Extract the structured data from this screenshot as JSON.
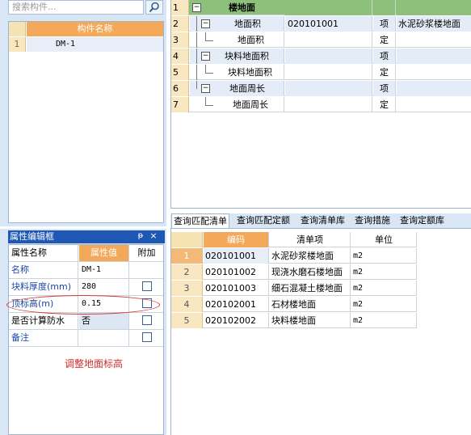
{
  "search": {
    "placeholder": "搜索构件..."
  },
  "components": {
    "header_name": "构件名称",
    "rows": [
      {
        "index": "1",
        "name": "DM-1"
      }
    ]
  },
  "property_panel": {
    "title": "属性编辑框",
    "pin_glyph": "ᵽ",
    "close_glyph": "×",
    "headers": {
      "name": "属性名称",
      "value": "属性值",
      "extra": "附加"
    },
    "rows": [
      {
        "name": "名称",
        "value": "DM-1",
        "checkbox": false
      },
      {
        "name": "块料厚度(mm)",
        "value": "280",
        "checkbox": true
      },
      {
        "name": "顶标高(m)",
        "value": "0.15",
        "checkbox": true
      },
      {
        "name": "是否计算防水",
        "value": "否",
        "checkbox": true
      },
      {
        "name": "备注",
        "value": "",
        "checkbox": true
      }
    ],
    "annotation": "调整地面标高"
  },
  "tree": {
    "rows": [
      {
        "index": "1",
        "label": "楼地面",
        "code": "",
        "unit": "",
        "desc": ""
      },
      {
        "index": "2",
        "label": "地面积",
        "code": "020101001",
        "unit": "项",
        "desc": "水泥砂浆楼地面"
      },
      {
        "index": "3",
        "label": "地面积",
        "code": "",
        "unit": "定",
        "desc": ""
      },
      {
        "index": "4",
        "label": "块料地面积",
        "code": "",
        "unit": "项",
        "desc": ""
      },
      {
        "index": "5",
        "label": "块料地面积",
        "code": "",
        "unit": "定",
        "desc": ""
      },
      {
        "index": "6",
        "label": "地面周长",
        "code": "",
        "unit": "项",
        "desc": ""
      },
      {
        "index": "7",
        "label": "地面周长",
        "code": "",
        "unit": "定",
        "desc": ""
      }
    ],
    "collapse_glyph": "−"
  },
  "tabs": [
    {
      "label": "查询匹配清单",
      "active": true
    },
    {
      "label": "查询匹配定额",
      "active": false
    },
    {
      "label": "查询清单库",
      "active": false
    },
    {
      "label": "查询措施",
      "active": false
    },
    {
      "label": "查询定额库",
      "active": false
    }
  ],
  "match_table": {
    "headers": {
      "code": "编码",
      "name": "清单项",
      "unit": "单位"
    },
    "rows": [
      {
        "index": "1",
        "code": "020101001",
        "name": "水泥砂浆楼地面",
        "unit": "m2"
      },
      {
        "index": "2",
        "code": "020101002",
        "name": "现浇水磨石楼地面",
        "unit": "m2"
      },
      {
        "index": "3",
        "code": "020101003",
        "name": "细石混凝土楼地面",
        "unit": "m2"
      },
      {
        "index": "4",
        "code": "020102001",
        "name": "石材楼地面",
        "unit": "m2"
      },
      {
        "index": "5",
        "code": "020102002",
        "name": "块料楼地面",
        "unit": "m2"
      }
    ]
  }
}
